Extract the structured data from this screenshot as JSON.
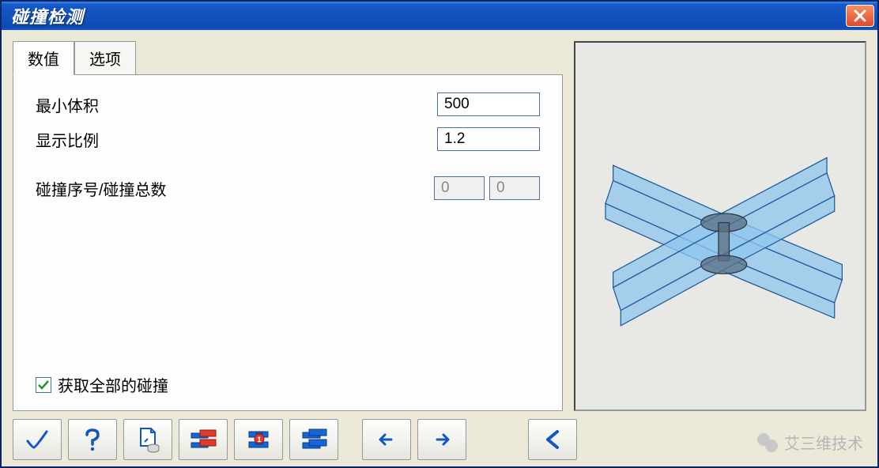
{
  "window": {
    "title": "碰撞检测"
  },
  "tabs": {
    "values_label": "数值",
    "options_label": "选项"
  },
  "form": {
    "min_volume_label": "最小体积",
    "min_volume_value": "500",
    "display_scale_label": "显示比例",
    "display_scale_value": "1.2",
    "collision_index_label": "碰撞序号/碰撞总数",
    "collision_index_value": "0",
    "collision_total_value": "0",
    "get_all_label": "获取全部的碰撞",
    "get_all_checked": true
  },
  "toolbar": {
    "confirm": "confirm",
    "help": "help",
    "copy_settings": "copy-settings",
    "clash_red": "clash-highlight",
    "clash_shirt": "clash-component",
    "clash_blue": "clash-pair",
    "prev": "previous",
    "next": "next",
    "last": "rewind"
  },
  "watermark": {
    "text": "艾三维技术"
  }
}
